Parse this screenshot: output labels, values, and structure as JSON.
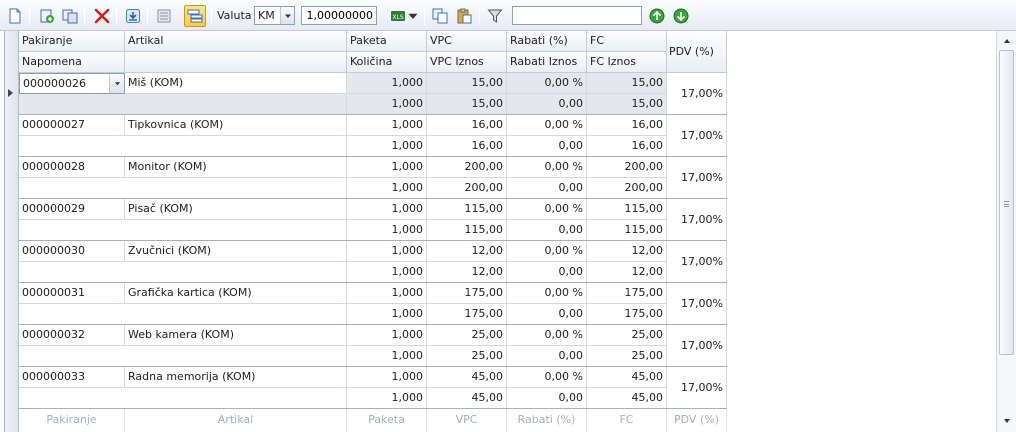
{
  "toolbar": {
    "currency_label": "Valuta",
    "currency_value": "KM",
    "exchange_rate": "1,00000000",
    "search_value": ""
  },
  "columns": {
    "row1": [
      "Pakiranje",
      "Artikal",
      "Paketa",
      "VPC",
      "Rabati (%)",
      "FC"
    ],
    "row2": [
      "Napomena",
      "",
      "Količina",
      "VPC Iznos",
      "Rabati Iznos",
      "FC Iznos"
    ],
    "pdv": "PDV (%)"
  },
  "rows": [
    {
      "code": "000000026",
      "article": "Miš (KOM)",
      "paketa": "1,000",
      "vpc": "15,00",
      "rabat_pct": "0,00 %",
      "fc": "15,00",
      "napomena": "",
      "kolicina": "1,000",
      "vpc_iznos": "15,00",
      "rabat_iznos": "0,00",
      "fc_iznos": "15,00",
      "pdv": "17,00%"
    },
    {
      "code": "000000027",
      "article": "Tipkovnica (KOM)",
      "paketa": "1,000",
      "vpc": "16,00",
      "rabat_pct": "0,00 %",
      "fc": "16,00",
      "napomena": "",
      "kolicina": "1,000",
      "vpc_iznos": "16,00",
      "rabat_iznos": "0,00",
      "fc_iznos": "16,00",
      "pdv": "17,00%"
    },
    {
      "code": "000000028",
      "article": "Monitor (KOM)",
      "paketa": "1,000",
      "vpc": "200,00",
      "rabat_pct": "0,00 %",
      "fc": "200,00",
      "napomena": "",
      "kolicina": "1,000",
      "vpc_iznos": "200,00",
      "rabat_iznos": "0,00",
      "fc_iznos": "200,00",
      "pdv": "17,00%"
    },
    {
      "code": "000000029",
      "article": "Pisač (KOM)",
      "paketa": "1,000",
      "vpc": "115,00",
      "rabat_pct": "0,00 %",
      "fc": "115,00",
      "napomena": "",
      "kolicina": "1,000",
      "vpc_iznos": "115,00",
      "rabat_iznos": "0,00",
      "fc_iznos": "115,00",
      "pdv": "17,00%"
    },
    {
      "code": "000000030",
      "article": "Zvučnici (KOM)",
      "paketa": "1,000",
      "vpc": "12,00",
      "rabat_pct": "0,00 %",
      "fc": "12,00",
      "napomena": "",
      "kolicina": "1,000",
      "vpc_iznos": "12,00",
      "rabat_iznos": "0,00",
      "fc_iznos": "12,00",
      "pdv": "17,00%"
    },
    {
      "code": "000000031",
      "article": "Grafička kartica (KOM)",
      "paketa": "1,000",
      "vpc": "175,00",
      "rabat_pct": "0,00 %",
      "fc": "175,00",
      "napomena": "",
      "kolicina": "1,000",
      "vpc_iznos": "175,00",
      "rabat_iznos": "0,00",
      "fc_iznos": "175,00",
      "pdv": "17,00%"
    },
    {
      "code": "000000032",
      "article": "Web kamera (KOM)",
      "paketa": "1,000",
      "vpc": "25,00",
      "rabat_pct": "0,00 %",
      "fc": "25,00",
      "napomena": "",
      "kolicina": "1,000",
      "vpc_iznos": "25,00",
      "rabat_iznos": "0,00",
      "fc_iznos": "25,00",
      "pdv": "17,00%"
    },
    {
      "code": "000000033",
      "article": "Radna memorija (KOM)",
      "paketa": "1,000",
      "vpc": "45,00",
      "rabat_pct": "0,00 %",
      "fc": "45,00",
      "napomena": "",
      "kolicina": "1,000",
      "vpc_iznos": "45,00",
      "rabat_iznos": "0,00",
      "fc_iznos": "45,00",
      "pdv": "17,00%"
    }
  ],
  "footer": [
    "Pakiranje",
    "Artikal",
    "Paketa",
    "VPC",
    "Rabati (%)",
    "FC",
    "PDV (%)"
  ],
  "colors": {
    "accent": "#ffc94a",
    "delete": "#d32020",
    "header_border": "#c7ccd4"
  }
}
